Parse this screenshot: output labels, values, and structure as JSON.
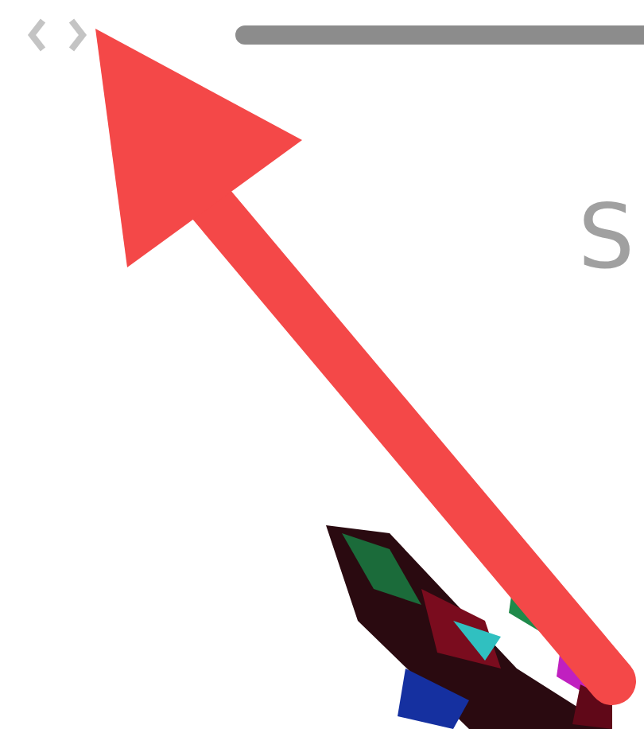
{
  "heading": {
    "text": "S"
  }
}
